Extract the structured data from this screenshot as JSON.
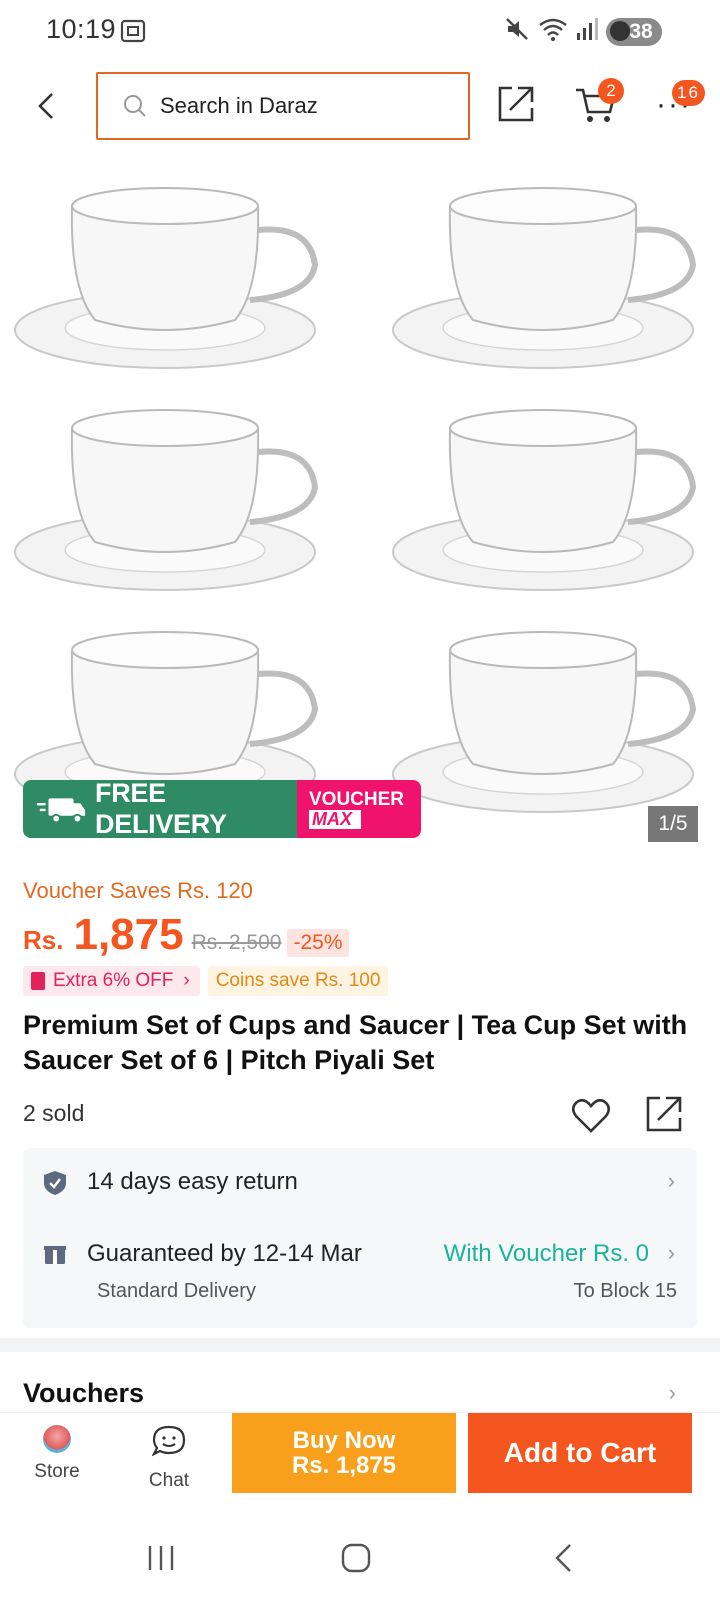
{
  "status_bar": {
    "time": "10:19",
    "battery": "38"
  },
  "header": {
    "search_placeholder": "Search in Daraz",
    "cart_count": "2",
    "more_count": "16"
  },
  "gallery": {
    "counter": "1/5",
    "promo_free": "FREE DELIVERY",
    "promo_voucher_line1": "VOUCHER",
    "promo_voucher_line2": "MAX"
  },
  "pricing": {
    "voucher_saves": "Voucher Saves Rs. 120",
    "currency": "Rs.",
    "price": "1,875",
    "old_price": "Rs. 2,500",
    "discount": "-25%",
    "extra_off": "Extra 6% OFF",
    "coins": "Coins save Rs. 100"
  },
  "product": {
    "title": "Premium Set of Cups and Saucer | Tea Cup Set with Saucer Set of 6 | Pitch Piyali Set",
    "sold": "2 sold"
  },
  "info": {
    "return_text": "14 days easy return",
    "delivery_text": "Guaranteed by 12-14 Mar",
    "delivery_voucher": "With Voucher Rs. 0",
    "delivery_type": "Standard Delivery",
    "delivery_to": "To Block 15"
  },
  "vouchers": {
    "title": "Vouchers"
  },
  "bottom_bar": {
    "store_label": "Store",
    "chat_label": "Chat",
    "buy_now_line1": "Buy Now",
    "buy_now_line2": "Rs. 1,875",
    "add_to_cart": "Add to Cart"
  },
  "colors": {
    "accent": "#f5551e",
    "search_border": "#e3681f",
    "buy_now": "#f8a01c",
    "free_delivery": "#2e8b63",
    "voucher_max": "#f0136d",
    "voucher_text": "#19b39c"
  }
}
